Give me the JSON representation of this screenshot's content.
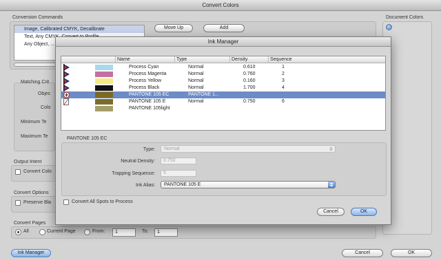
{
  "convert_colors": {
    "title": "Convert Colors",
    "conversion_commands_label": "Conversion Commands",
    "commands": [
      "Image, Calibrated CMYK, Decalibrate",
      "Text, Any CMYK, Convert to Profile",
      "Any Object, ..."
    ],
    "move_up_label": "Move Up",
    "add_label": "Add",
    "document_colors_label": "Document Colors",
    "matching_criteria_label": "Matching Crit",
    "object_label": "Objec",
    "color_label": "Colo",
    "min_text_label": "Minimum Te",
    "max_text_label": "Maximum Te",
    "output_intent_label": "Output Intent",
    "convert_colors_cb_label": "Convert Colo",
    "convert_options_label": "Convert Options",
    "preserve_black_label": "Preserve Bla",
    "convert_pages_label": "Convert Pages",
    "all_label": "All",
    "current_page_label": "Current Page",
    "from_label": "From:",
    "from_value": "1",
    "to_label": "To:",
    "to_value": "1",
    "ink_manager_button": "Ink Manager",
    "cancel_label": "Cancel",
    "ok_label": "OK"
  },
  "ink_manager": {
    "title": "Ink Manager",
    "columns": [
      "Name",
      "Type",
      "Density",
      "Sequence"
    ],
    "inks": [
      {
        "icon": "process-ink-icon",
        "color": "#a9d8ea",
        "name": "Process Cyan",
        "type": "Normal",
        "density": "0.610",
        "sequence": "1",
        "selected": false
      },
      {
        "icon": "process-ink-icon",
        "color": "#c4709f",
        "name": "Process Magenta",
        "type": "Normal",
        "density": "0.760",
        "sequence": "2",
        "selected": false
      },
      {
        "icon": "process-ink-icon",
        "color": "#f3ec84",
        "name": "Process Yellow",
        "type": "Normal",
        "density": "0.160",
        "sequence": "3",
        "selected": false
      },
      {
        "icon": "process-ink-icon",
        "color": "#111111",
        "name": "Process Black",
        "type": "Normal",
        "density": "1.700",
        "sequence": "4",
        "selected": false
      },
      {
        "icon": "ink-alias-icon",
        "color": "#7c6a1f",
        "name": "PANTONE 105 EC",
        "type": "PANTONE 1...",
        "density": "",
        "sequence": "",
        "selected": true
      },
      {
        "icon": "spot-ink-icon",
        "color": "#7b6c2b",
        "name": "PANTONE 105 E",
        "type": "Normal",
        "density": "0.750",
        "sequence": "6",
        "selected": false
      },
      {
        "icon": "none",
        "color": "#a59d6a",
        "name": "PANTONE 105light",
        "type": "",
        "density": "",
        "sequence": "",
        "selected": false
      }
    ],
    "selected_ink_name": "PANTONE 105 EC",
    "type_label": "Type:",
    "type_value": "Normal",
    "neutral_density_label": "Neutral Density:",
    "neutral_density_value": "0.750",
    "trapping_sequence_label": "Trapping Sequence:",
    "trapping_sequence_value": "5",
    "ink_alias_label": "Ink Alias:",
    "ink_alias_value": "PANTONE 105 E",
    "convert_spots_label": "Convert All Spots to Process",
    "cancel_label": "Cancel",
    "ok_label": "OK"
  },
  "colors": {
    "selection": "#6d8bc5",
    "default_button": "#8fb4e8"
  }
}
